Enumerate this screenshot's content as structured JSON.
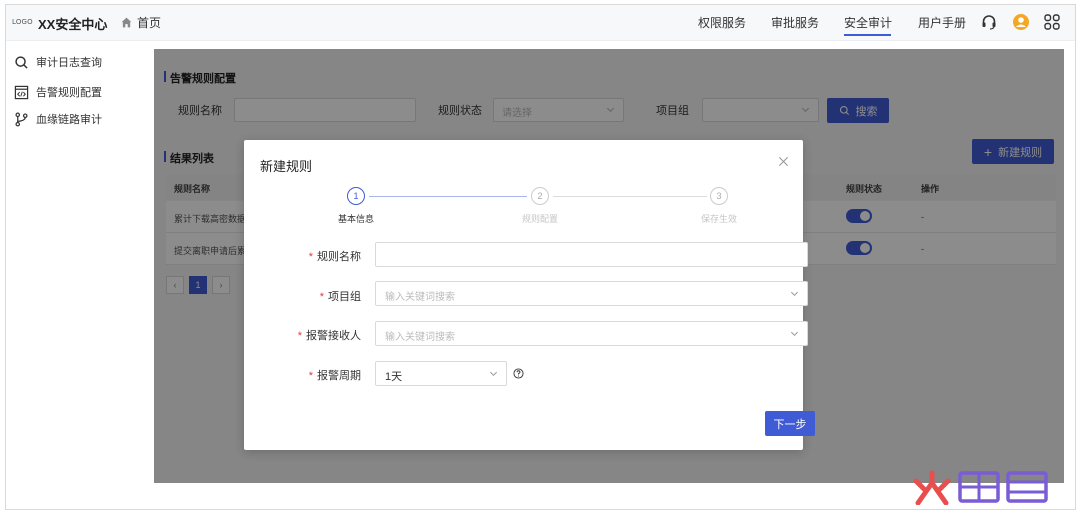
{
  "header": {
    "logo": "LOGO",
    "app_title": "XX安全中心",
    "home": "首页",
    "nav": [
      "权限服务",
      "审批服务",
      "安全审计",
      "用户手册"
    ],
    "active_nav": "安全审计"
  },
  "sidebar": {
    "items": [
      {
        "label": "审计日志查询",
        "icon": "search-icon"
      },
      {
        "label": "告警规则配置",
        "icon": "code-window-icon"
      },
      {
        "label": "血缘链路审计",
        "icon": "branch-icon"
      }
    ]
  },
  "main": {
    "config_title": "告警规则配置",
    "filters": {
      "rule_name_label": "规则名称",
      "rule_status_label": "规则状态",
      "rule_status_placeholder": "请选择",
      "project_group_label": "项目组",
      "search_button": "搜索"
    },
    "results_title": "结果列表",
    "new_rule_button": "新建规则",
    "table": {
      "columns": [
        "规则名称",
        "规则状态",
        "操作"
      ],
      "rows": [
        {
          "name": "累计下载高密数据",
          "action": "-"
        },
        {
          "name": "提交离职申请后累",
          "action": "-"
        }
      ]
    },
    "pagination": {
      "prev": "‹",
      "current": "1",
      "next": "›"
    }
  },
  "modal": {
    "title": "新建规则",
    "steps": [
      {
        "num": "1",
        "label": "基本信息"
      },
      {
        "num": "2",
        "label": "规则配置"
      },
      {
        "num": "3",
        "label": "保存生效"
      }
    ],
    "fields": {
      "rule_name_label": "规则名称",
      "project_group_label": "项目组",
      "project_group_placeholder": "输入关键词搜索",
      "receiver_label": "报警接收人",
      "receiver_placeholder": "输入关键词搜索",
      "period_label": "报警周期",
      "period_value": "1天",
      "required_mark": "*"
    },
    "next_button": "下一步"
  },
  "colors": {
    "primary": "#3f5bd6",
    "required": "#e4393c",
    "watermark": "#e94e4e"
  }
}
